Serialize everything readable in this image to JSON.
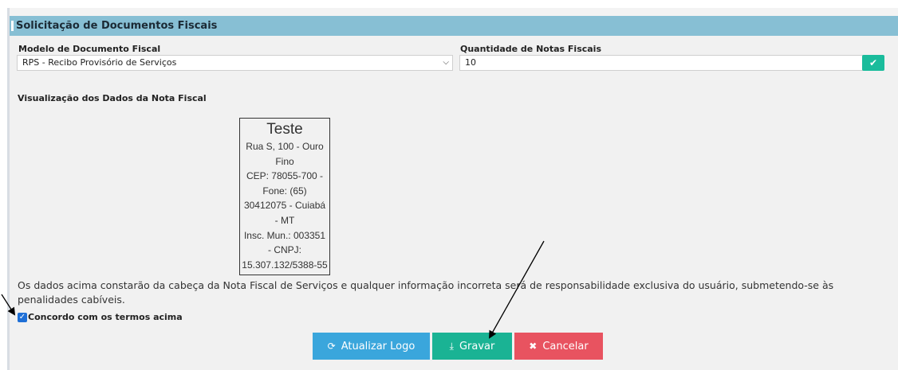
{
  "panel": {
    "title": "Solicitação de Documentos Fiscais"
  },
  "form": {
    "model_label": "Modelo de Documento Fiscal",
    "model_value": "RPS - Recibo Provisório de Serviços",
    "quantity_label": "Quantidade de Notas Fiscais",
    "quantity_value": "10",
    "confirm_icon": "check-icon"
  },
  "preview": {
    "section_label": "Visualização dos Dados da Nota Fiscal",
    "company_name": "Teste",
    "address_lines": [
      "Rua S, 100 - Ouro",
      "Fino",
      "CEP: 78055-700 -",
      "Fone: (65)",
      "30412075 - Cuiabá",
      "- MT",
      "Insc. Mun.: 003351",
      "- CNPJ:",
      "15.307.132/5388-55"
    ]
  },
  "notice": "Os dados acima constarão da cabeça da Nota Fiscal de Serviços e qualquer informação incorreta será de responsabilidade exclusiva do usuário, submetendo-se às penalidades cabíveis.",
  "agree": {
    "label": "Concordo com os termos acima",
    "checked": true
  },
  "buttons": {
    "update_logo": "Atualizar Logo",
    "save": "Gravar",
    "cancel": "Cancelar"
  },
  "colors": {
    "header": "#87bfd4",
    "confirm": "#1abc9c",
    "update_logo": "#3aa6dc",
    "save": "#1ab394",
    "cancel": "#e85360"
  }
}
